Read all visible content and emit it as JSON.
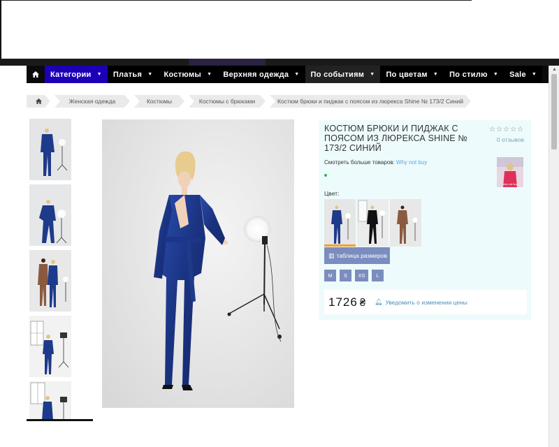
{
  "nav": {
    "home_icon": "home-icon",
    "items": [
      {
        "label": "Категории"
      },
      {
        "label": "Платья"
      },
      {
        "label": "Костюмы"
      },
      {
        "label": "Верхняя одежда"
      },
      {
        "label": "По событиям"
      },
      {
        "label": "По цветам"
      },
      {
        "label": "По стилю"
      },
      {
        "label": "Sale"
      }
    ]
  },
  "breadcrumb": {
    "home_icon": "home-icon",
    "items": [
      {
        "label": "Женская одежда"
      },
      {
        "label": "Костюмы"
      },
      {
        "label": "Костюмы с брюками"
      },
      {
        "label": "Костюм брюки и пиджак с поясом из люрекса Shine № 173/2 Синий"
      }
    ]
  },
  "product": {
    "title": "КОСТЮМ БРЮКИ И ПИДЖАК С ПОЯСОМ ИЗ ЛЮРЕКСА SHINE № 173/2 СИНИЙ",
    "stars": "☆☆☆☆☆",
    "reviews": "0 отзывов",
    "more_label": "Смотреть больше товаров:",
    "more_link": "Why not buy",
    "color_label": "Цвет:",
    "size_chart_label": "таблица размеров",
    "sizes": [
      "M",
      "S",
      "XS",
      "L"
    ],
    "price": "1726",
    "currency": "₴",
    "notify_label": "Уведомить о изменении цены"
  },
  "colors": {
    "nav_bg": "#0a0a0a",
    "nav_active": "#1c00b8",
    "panel_bg": "#eefbfc",
    "button": "#7b8dbf",
    "link": "#5aa6d6",
    "suit_blue": "#1e3a8a"
  }
}
